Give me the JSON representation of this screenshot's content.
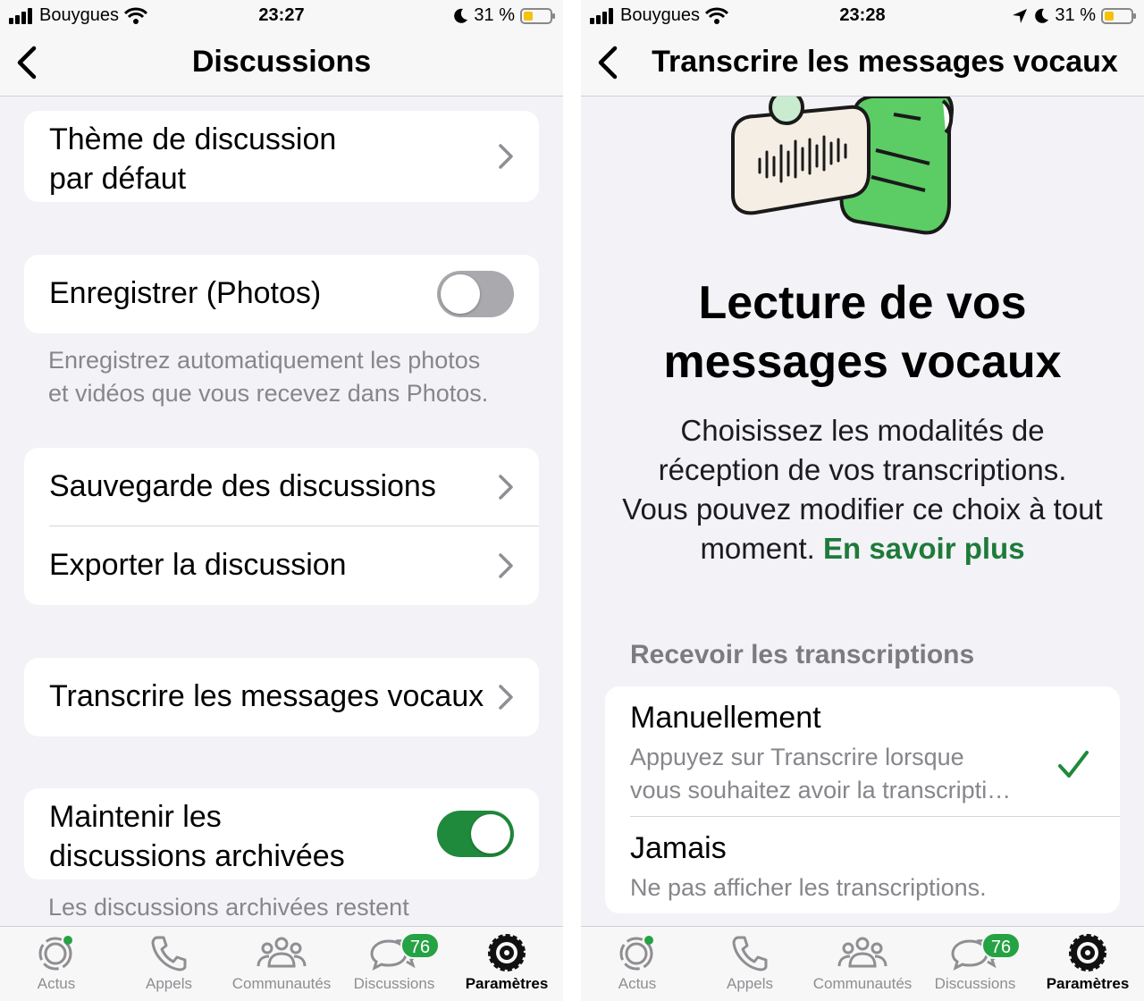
{
  "colors": {
    "accent_green": "#1f8a3b",
    "badge_green": "#25a244",
    "link_green": "#1f7a3a",
    "battery_yellow": "#f4c20d"
  },
  "left": {
    "status": {
      "carrier": "Bouygues",
      "time": "23:27",
      "battery": "31 %"
    },
    "nav": {
      "title": "Discussions"
    },
    "rows": {
      "theme_line1": "Thème de discussion",
      "theme_line2": "par défaut",
      "save_photos": "Enregistrer (Photos)",
      "save_photos_note_1": "Enregistrez automatiquement les photos",
      "save_photos_note_2": "et vidéos que vous recevez dans Photos.",
      "backup": "Sauvegarde des discussions",
      "export": "Exporter la discussion",
      "transcribe": "Transcrire les messages vocaux",
      "keep_archived_1": "Maintenir les",
      "keep_archived_2": "discussions archivées",
      "archived_note": "Les discussions archivées restent"
    },
    "toggles": {
      "save_photos": "off",
      "keep_archived": "on"
    }
  },
  "right": {
    "status": {
      "carrier": "Bouygues",
      "time": "23:28",
      "battery": "31 %"
    },
    "nav": {
      "title": "Transcrire les messages vocaux"
    },
    "hero_line1": "Lecture de vos",
    "hero_line2": "messages vocaux",
    "desc_1": "Choisissez les modalités de",
    "desc_2": "réception de vos transcriptions.",
    "desc_3": "Vous pouvez modifier ce choix à tout",
    "desc_4": "moment.",
    "desc_link": "En savoir plus",
    "section": "Recevoir les transcriptions",
    "options": [
      {
        "title": "Manuellement",
        "sub1": "Appuyez sur Transcrire lorsque",
        "sub2": "vous souhaitez avoir la transcripti…",
        "selected": true
      },
      {
        "title": "Jamais",
        "sub1": "Ne pas afficher les transcriptions.",
        "selected": false
      }
    ]
  },
  "tabbar": {
    "tabs": [
      {
        "label": "Actus",
        "icon": "status-icon"
      },
      {
        "label": "Appels",
        "icon": "phone-icon"
      },
      {
        "label": "Communautés",
        "icon": "communities-icon"
      },
      {
        "label": "Discussions",
        "icon": "chats-icon",
        "badge": "76"
      },
      {
        "label": "Paramètres",
        "icon": "settings-icon",
        "active": true
      }
    ]
  }
}
